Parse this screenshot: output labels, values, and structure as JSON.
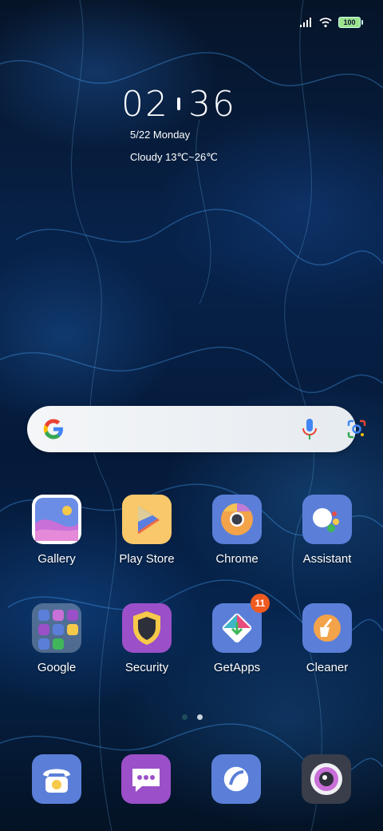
{
  "status_bar": {
    "battery": "100"
  },
  "clock": {
    "hours": "02",
    "minutes": "36"
  },
  "date": "5/22 Monday",
  "weather": "Cloudy 13℃~26℃",
  "apps_row1": [
    "Gallery",
    "Play Store",
    "Chrome",
    "Assistant"
  ],
  "apps_row2": [
    "Google",
    "Security",
    "GetApps",
    "Cleaner"
  ],
  "getapps_badge": "11",
  "icons": {
    "gallery": "gallery-icon",
    "play_store": "play-store-icon",
    "chrome": "chrome-icon",
    "assistant": "assistant-icon",
    "google_folder": "folder-icon",
    "security": "shield-icon",
    "getapps": "getapps-icon",
    "cleaner": "cleaner-icon",
    "phone": "phone-icon",
    "messages": "messages-icon",
    "browser": "browser-icon",
    "camera": "camera-icon"
  },
  "colors": {
    "icon_blue": "#5b7fd8",
    "security_purple": "#9b4fc8",
    "badge": "#f05a1e"
  }
}
